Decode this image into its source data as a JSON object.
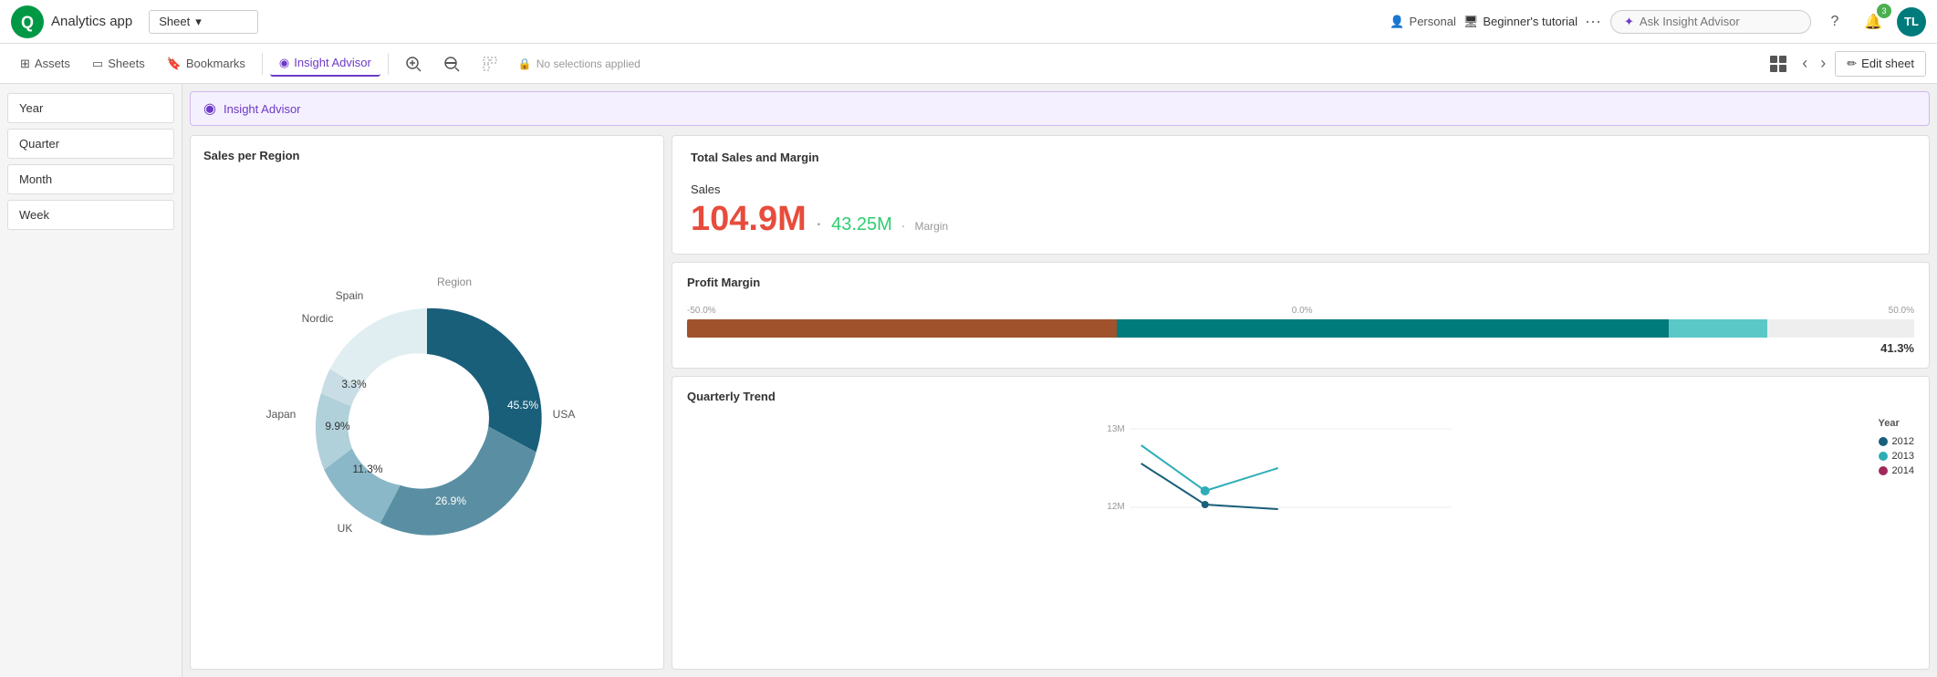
{
  "topbar": {
    "app_name": "Analytics app",
    "sheet_label": "Sheet",
    "personal_label": "Personal",
    "tutorial_label": "Beginner's tutorial",
    "insight_placeholder": "Ask Insight Advisor",
    "avatar_initials": "TL",
    "badge_count": "3"
  },
  "toolbar": {
    "assets": "Assets",
    "sheets": "Sheets",
    "bookmarks": "Bookmarks",
    "insight_advisor": "Insight Advisor",
    "no_selections": "No selections applied",
    "edit_sheet": "Edit sheet"
  },
  "filters": [
    {
      "label": "Year"
    },
    {
      "label": "Quarter"
    },
    {
      "label": "Month"
    },
    {
      "label": "Week"
    }
  ],
  "insight_panel": {
    "text": "Insight Advisor"
  },
  "sales_per_region": {
    "title": "Sales per Region",
    "segments": [
      {
        "label": "USA",
        "value": 45.5,
        "color": "#1a5f7a",
        "pct": "45.5%"
      },
      {
        "label": "UK",
        "value": 26.9,
        "color": "#5a8fa3",
        "pct": "26.9%"
      },
      {
        "label": "Japan",
        "value": 11.3,
        "color": "#8ab8c8",
        "pct": "11.3%"
      },
      {
        "label": "Nordic",
        "value": 9.9,
        "color": "#b0d0da",
        "pct": "9.9%"
      },
      {
        "label": "Spain",
        "value": 3.3,
        "color": "#c8dde5",
        "pct": "3.3%"
      }
    ],
    "legend_title": "Region"
  },
  "total_sales": {
    "title": "Total Sales and Margin",
    "sales_label": "Sales",
    "sales_value": "104.9M",
    "margin_value": "43.25M",
    "margin_label": "Margin"
  },
  "profit_margin": {
    "title": "Profit Margin",
    "axis_left": "-50.0%",
    "axis_center": "0.0%",
    "axis_right": "50.0%",
    "value": "41.3%"
  },
  "quarterly_trend": {
    "title": "Quarterly Trend",
    "y_top": "13M",
    "y_bottom": "12M",
    "legend_title": "Year",
    "years": [
      {
        "label": "2012",
        "color": "#1a5f7a"
      },
      {
        "label": "2013",
        "color": "#2eadb8"
      },
      {
        "label": "2014",
        "color": "#a0295a"
      }
    ]
  }
}
